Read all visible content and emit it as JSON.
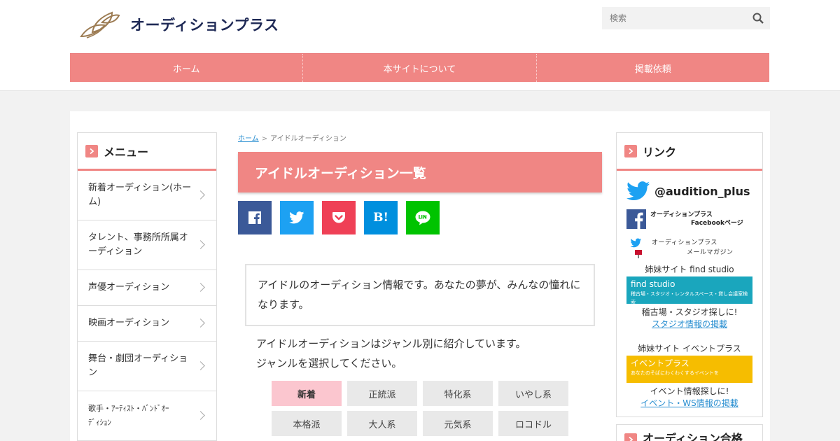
{
  "header": {
    "site_name": "オーディションプラス",
    "search_placeholder": "検索"
  },
  "nav": [
    "ホーム",
    "本サイトについて",
    "掲載依頼"
  ],
  "sidebar_left": {
    "title": "メニュー",
    "items": [
      {
        "line1": "新着オーディション(ホー",
        "line2": "ム)"
      },
      {
        "line1": "タレント、事務所所属オ",
        "line2": "ーディション"
      },
      {
        "line1": "声優オーディション",
        "line2": ""
      },
      {
        "line1": "映画オーディション",
        "line2": ""
      },
      {
        "line1": "舞台・劇団オーディショ",
        "line2": "ン"
      },
      {
        "line1": "歌手・ｱｰﾃｨｽﾄ・ﾊﾞﾝﾄﾞｵｰ",
        "line2": "ﾃﾞｨｼｮﾝ"
      }
    ]
  },
  "breadcrumb": {
    "home": "ホーム",
    "sep": ">",
    "current": "アイドルオーディション"
  },
  "page_title": "アイドルオーディション一覧",
  "share": [
    "facebook",
    "twitter",
    "pocket",
    "hatena-bookmark",
    "line"
  ],
  "hatena_label": "B!",
  "intro": "アイドルのオーディション情報です。あなたの夢が、みんなの憧れになります。",
  "desc": {
    "line1": "アイドルオーディションはジャンル別に紹介しています。",
    "line2": "ジャンルを選択してください。"
  },
  "genres": {
    "row1": [
      "新着",
      "正統派",
      "特化系",
      "いやし系"
    ],
    "row2": [
      "本格派",
      "大人系",
      "元気系",
      "ロコドル"
    ],
    "active": "新着"
  },
  "sidebar_right": {
    "title": "リンク",
    "twitter_handle": "@audition_plus",
    "fb_line1": "オーディションプラス",
    "fb_line2": "Facebookページ",
    "mail_line1": "オーディションプラス",
    "mail_line2": "メールマガジン",
    "sister1_label": "姉妹サイト find studio",
    "find_banner_title": "find studio",
    "find_banner_sub": "稽古場・スタジオ・レンタルスペース・貸し会議室検索",
    "sister1_caption": "稽古場・スタジオ探しに!",
    "sister1_link": "スタジオ情報の掲載",
    "sister2_label": "姉妹サイト イベントプラス",
    "event_banner_title": "イベントプラス",
    "event_banner_sub": "あなたのそばにわくわくするイベントを",
    "sister2_caption": "イベント情報探しに!",
    "sister2_link": "イベント・WS情報の掲載",
    "next_widget_title": "オーディション合格"
  },
  "colors": {
    "accent": "#f08684",
    "facebook": "#3b5998",
    "twitter": "#1da1f2",
    "pocket": "#ef4056",
    "hatena": "#008fde",
    "line": "#00c300"
  }
}
